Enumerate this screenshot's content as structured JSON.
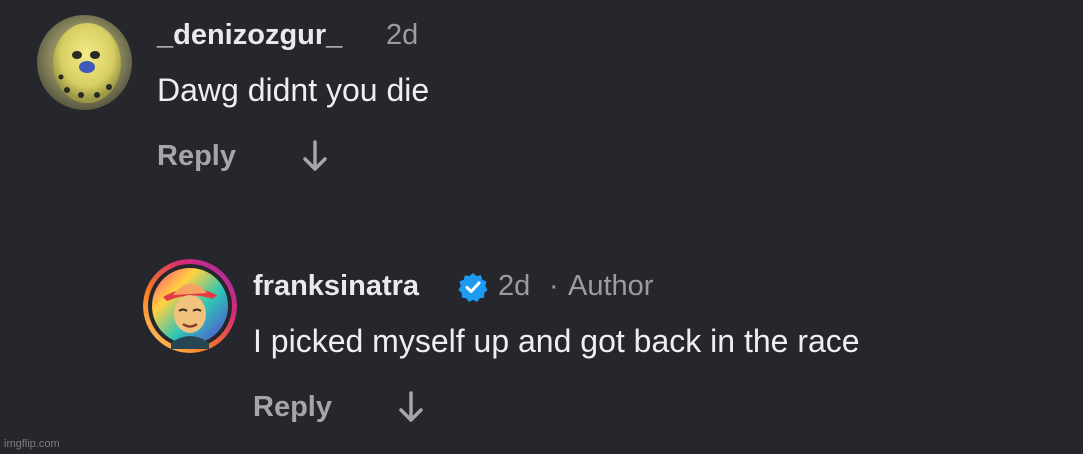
{
  "comments": [
    {
      "username": "_denizozgur_",
      "time": "2d",
      "author_tag": "",
      "text": "Dawg didnt you die",
      "reply_label": "Reply",
      "verified": false,
      "avatar_icon": "parakeet-photo"
    },
    {
      "username": "franksinatra",
      "time": "2d",
      "author_sep": "·",
      "author_tag": "Author",
      "text": "I picked myself up and got back in the race",
      "reply_label": "Reply",
      "verified": true,
      "avatar_icon": "frank-sinatra-portrait"
    }
  ],
  "icons": {
    "reply_arrow": "arrow-down-icon",
    "verified": "verified-badge-icon"
  },
  "colors": {
    "background": "#25272c",
    "verified_blue": "#1d9bf0",
    "story_ring_start": "#feda75",
    "story_ring_mid": "#fa7e1e",
    "story_ring_end": "#d62976"
  },
  "watermark": "imgflip.com"
}
